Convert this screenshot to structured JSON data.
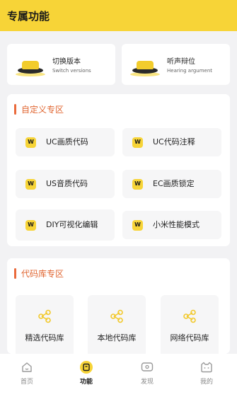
{
  "header": {
    "title": "专属功能"
  },
  "top_cards": [
    {
      "cn": "切换版本",
      "en": "Switch versions"
    },
    {
      "cn": "听声辩位",
      "en": "Hearing argument"
    }
  ],
  "custom_section": {
    "title": "自定义专区",
    "badge": "W",
    "items": [
      {
        "label": "UC画质代码"
      },
      {
        "label": "UC代码注释"
      },
      {
        "label": "US音质代码"
      },
      {
        "label": "EC画质锁定"
      },
      {
        "label": "DIY可视化编辑"
      },
      {
        "label": "小米性能模式"
      }
    ]
  },
  "code_library": {
    "title": "代码库专区",
    "items": [
      {
        "label": "精选代码库"
      },
      {
        "label": "本地代码库"
      },
      {
        "label": "网络代码库"
      }
    ]
  },
  "tabbar": {
    "tabs": [
      {
        "label": "首页",
        "icon": "home-icon"
      },
      {
        "label": "功能",
        "icon": "function-icon",
        "active": true
      },
      {
        "label": "发现",
        "icon": "discover-icon"
      },
      {
        "label": "我的",
        "icon": "profile-icon"
      }
    ]
  },
  "colors": {
    "accent": "#f7d437",
    "section_title": "#e06530"
  }
}
